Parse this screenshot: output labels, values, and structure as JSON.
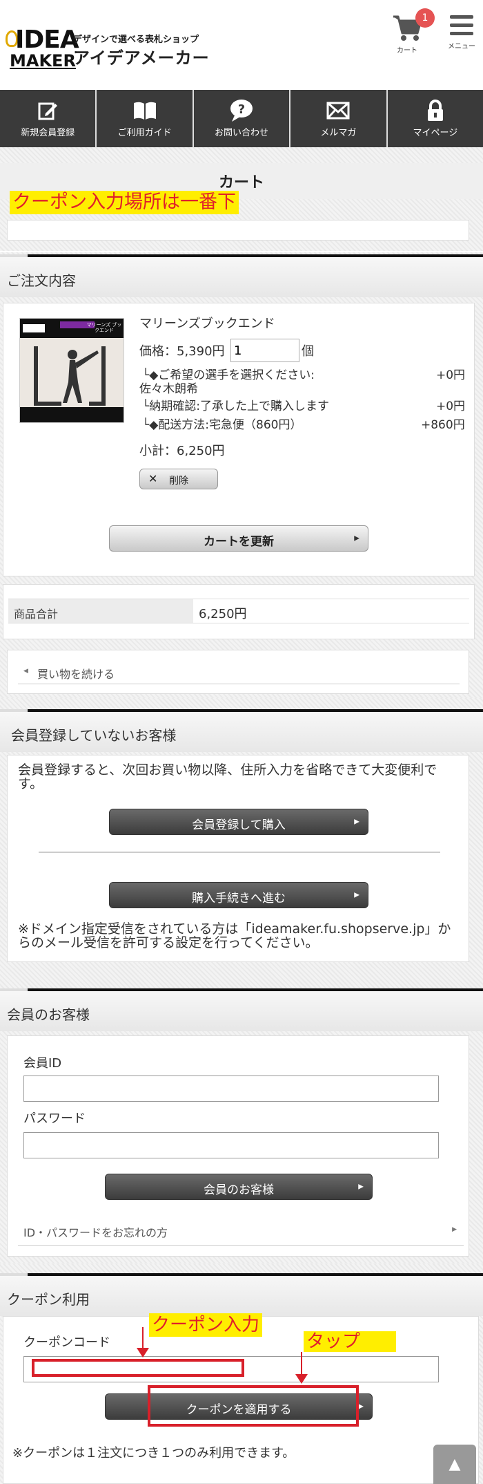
{
  "header": {
    "logo_idea": "IDEA",
    "logo_maker": "MAKER",
    "tagline": "デザインで選べる表札ショップ",
    "brand": "アイデアメーカー",
    "cart_label": "カート",
    "cart_count": "1",
    "menu_label": "メニュー"
  },
  "nav": [
    {
      "label": "新規会員登録",
      "icon": "edit-icon"
    },
    {
      "label": "ご利用ガイド",
      "icon": "book-icon"
    },
    {
      "label": "お問い合わせ",
      "icon": "question-icon"
    },
    {
      "label": "メルマガ",
      "icon": "mail-icon"
    },
    {
      "label": "マイページ",
      "icon": "lock-icon"
    }
  ],
  "page": {
    "title": "カート",
    "annotation_top": "クーポン入力場所は一番下"
  },
  "order": {
    "section_title": "ご注文内容",
    "product_name": "マリーンズブックエンド",
    "price_label": "価格：5,390円",
    "quantity": "1",
    "unit": "個",
    "option1_label": "└◆ご希望の選手を選択ください:",
    "option1_value": "佐々木朗希",
    "option1_price": "+0円",
    "option2_label": "└納期確認:了承した上で購入します",
    "option2_price": "+0円",
    "option3_label": "└◆配送方法:宅急便（860円）",
    "option3_price": "+860円",
    "subtotal": "小計：6,250円",
    "delete_label": "削除",
    "update_label": "カートを更新",
    "total_label": "商品合計",
    "total_value": "6,250円",
    "continue_label": "買い物を続ける",
    "image_title": "マリーンズ ブックエンド"
  },
  "guest": {
    "section_title": "会員登録していないお客様",
    "description": "会員登録すると、次回お買い物以降、住所入力を省略できて大変便利です。",
    "register_label": "会員登録して購入",
    "proceed_label": "購入手続きへ進む",
    "notice": "※ドメイン指定受信をされている方は「ideamaker.fu.shopserve.jp」からのメール受信を許可する設定を行ってください。"
  },
  "member": {
    "section_title": "会員のお客様",
    "id_label": "会員ID",
    "password_label": "パスワード",
    "login_label": "会員のお客様",
    "forgot_label": "ID・パスワードをお忘れの方"
  },
  "coupon": {
    "section_title": "クーポン利用",
    "code_label": "クーポンコード",
    "apply_label": "クーポンを適用する",
    "notice": "※クーポンは１注文につき１つのみ利用できます。",
    "annotation_input": "クーポン入力",
    "annotation_tap": "タップ"
  },
  "colors": {
    "annotation_red": "#d8202a",
    "annotation_yellow": "#ffee00",
    "nav_bg": "#3a3a3a",
    "badge": "#e55353"
  }
}
